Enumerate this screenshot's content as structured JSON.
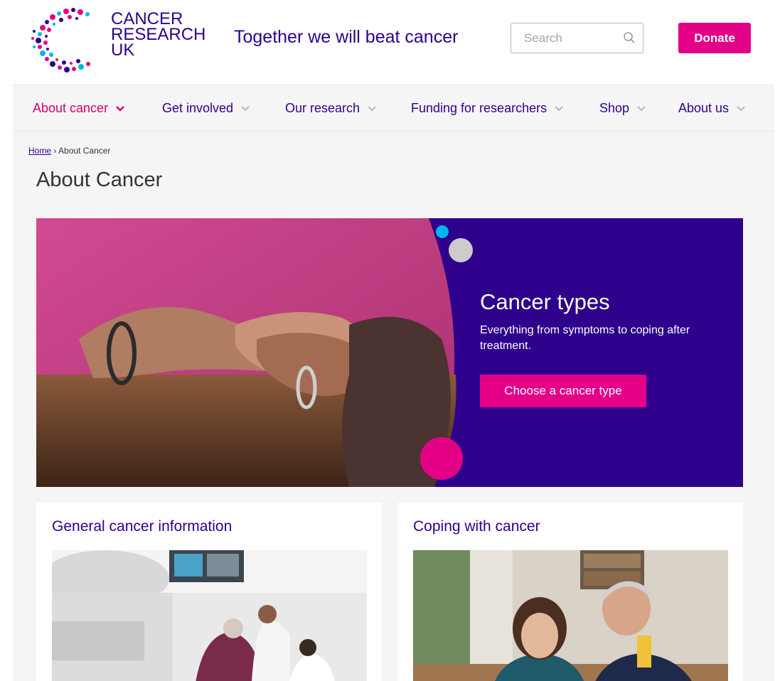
{
  "header": {
    "logo_lines": [
      "CANCER",
      "RESEARCH",
      "UK"
    ],
    "tagline": "Together we will beat cancer",
    "search_placeholder": "Search",
    "donate_label": "Donate"
  },
  "nav": {
    "items": [
      {
        "label": "About cancer",
        "active": true
      },
      {
        "label": "Get involved",
        "active": false
      },
      {
        "label": "Our research",
        "active": false
      },
      {
        "label": "Funding for researchers",
        "active": false
      },
      {
        "label": "Shop",
        "active": false
      },
      {
        "label": "About us",
        "active": false
      }
    ]
  },
  "breadcrumb": {
    "home": "Home",
    "separator": "›",
    "current": "About Cancer"
  },
  "page_title": "About Cancer",
  "hero": {
    "title": "Cancer types",
    "description": "Everything from symptoms to coping after treatment.",
    "button_label": "Choose a cancer type"
  },
  "cards": [
    {
      "title": "General cancer information"
    },
    {
      "title": "Coping with cancer"
    }
  ],
  "colors": {
    "brand_purple": "#2e008b",
    "brand_pink": "#e40087",
    "active_nav": "#d1006d",
    "background": "#f5f5f5"
  }
}
